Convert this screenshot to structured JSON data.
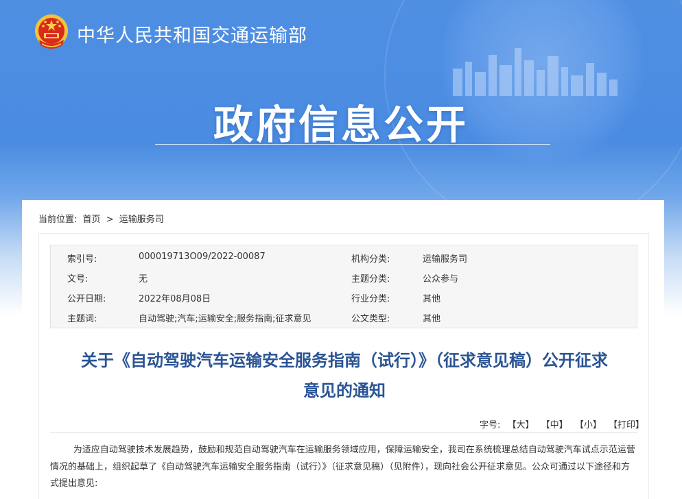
{
  "header": {
    "site_title": "中华人民共和国交通运输部",
    "hero_title": "政府信息公开"
  },
  "breadcrumb": {
    "prefix": "当前位置:",
    "items": [
      "首页",
      "运输服务司"
    ],
    "separator": ">"
  },
  "meta": {
    "rows": [
      {
        "k1": "索引号:",
        "v1": "000019713O09/2022-00087",
        "k2": "机构分类:",
        "v2": "运输服务司"
      },
      {
        "k1": "文号:",
        "v1": "无",
        "k2": "主题分类:",
        "v2": "公众参与"
      },
      {
        "k1": "公开日期:",
        "v1": "2022年08月08日",
        "k2": "行业分类:",
        "v2": "其他"
      },
      {
        "k1": "主题词:",
        "v1": "自动驾驶;汽车;运输安全;服务指南;征求意见",
        "k2": "公文类型:",
        "v2": "其他"
      }
    ]
  },
  "article": {
    "title_line1": "关于《自动驾驶汽车运输安全服务指南（试行）》（征求意见稿）公开征求",
    "title_line2": "意见的通知",
    "font_size_label": "字号:",
    "font_large": "【大】",
    "font_medium": "【中】",
    "font_small": "【小】",
    "print": "【打印】",
    "paragraph": "为适应自动驾驶技术发展趋势，鼓励和规范自动驾驶汽车在运输服务领域应用，保障运输安全，我司在系统梳理总结自动驾驶汽车试点示范运营情况的基础上，组织起草了《自动驾驶汽车运输安全服务指南（试行）》（征求意见稿）（见附件），现向社会公开征求意见。公众可通过以下途径和方式提出意见:"
  },
  "colors": {
    "banner_blue": "#4a8ce2",
    "title_blue": "#2a5494"
  }
}
